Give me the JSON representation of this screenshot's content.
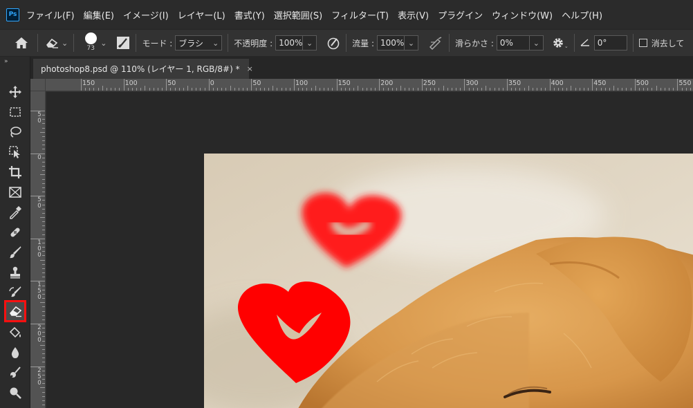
{
  "app": {
    "logo": "Ps"
  },
  "menu": [
    "ファイル(F)",
    "編集(E)",
    "イメージ(I)",
    "レイヤー(L)",
    "書式(Y)",
    "選択範囲(S)",
    "フィルター(T)",
    "表示(V)",
    "プラグイン",
    "ウィンドウ(W)",
    "ヘルプ(H)"
  ],
  "options": {
    "brush_size": "73",
    "mode_label": "モード :",
    "mode_value": "ブラシ",
    "opacity_label": "不透明度 :",
    "opacity_value": "100%",
    "flow_label": "流量 :",
    "flow_value": "100%",
    "smoothing_label": "滑らかさ :",
    "smoothing_value": "0%",
    "angle_value": "0°",
    "erase_history_label": "消去して"
  },
  "document": {
    "tab_title": "photoshop8.psd @ 110% (レイヤー 1, RGB/8#) *",
    "close_glyph": "×"
  },
  "ruler_h_labels": [
    "150",
    "100",
    "50",
    "0",
    "50",
    "100",
    "150",
    "200",
    "250",
    "300",
    "350",
    "400",
    "450",
    "500",
    "550"
  ],
  "ruler_v_labels": [
    "50",
    "0",
    "50",
    "100",
    "150",
    "200",
    "250"
  ],
  "tools": [
    {
      "name": "move-tool",
      "icon": "move-icon",
      "active": false
    },
    {
      "name": "marquee-tool",
      "icon": "marquee-icon",
      "active": false
    },
    {
      "name": "lasso-tool",
      "icon": "lasso-icon",
      "active": false
    },
    {
      "name": "object-selection-tool",
      "icon": "object-selection-icon",
      "active": false
    },
    {
      "name": "crop-tool",
      "icon": "crop-icon",
      "active": false
    },
    {
      "name": "frame-tool",
      "icon": "frame-icon",
      "active": false
    },
    {
      "name": "eyedropper-tool",
      "icon": "eyedropper-icon",
      "active": false
    },
    {
      "name": "healing-brush-tool",
      "icon": "bandage-icon",
      "active": false
    },
    {
      "name": "brush-tool",
      "icon": "brush-icon",
      "active": false
    },
    {
      "name": "clone-stamp-tool",
      "icon": "stamp-icon",
      "active": false
    },
    {
      "name": "history-brush-tool",
      "icon": "history-brush-icon",
      "active": false
    },
    {
      "name": "eraser-tool",
      "icon": "eraser-icon",
      "active": true
    },
    {
      "name": "paint-bucket-tool",
      "icon": "bucket-icon",
      "active": false
    },
    {
      "name": "blur-tool",
      "icon": "drop-icon",
      "active": false
    },
    {
      "name": "smudge-tool",
      "icon": "smudge-icon",
      "active": false
    },
    {
      "name": "dodge-tool",
      "icon": "dodge-icon",
      "active": false
    }
  ],
  "colors": {
    "highlight": "#ff1010",
    "heart": "#ff0000",
    "panel": "#2b2b2b",
    "canvas_bg": "#282828"
  }
}
